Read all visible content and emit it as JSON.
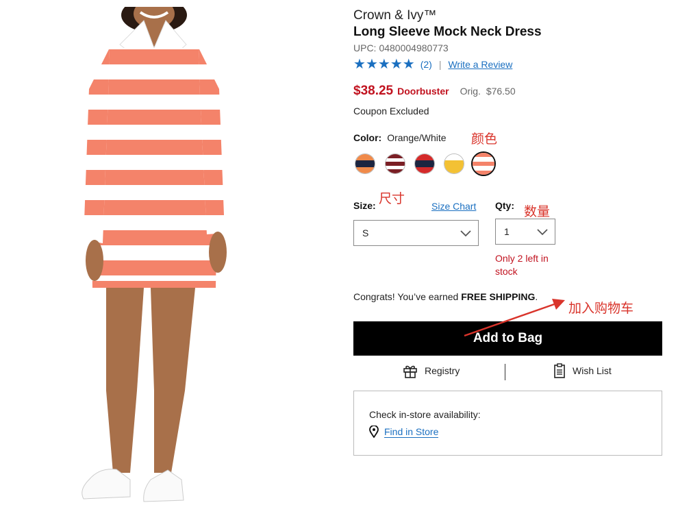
{
  "product": {
    "brand": "Crown & Ivy™",
    "title": "Long Sleeve Mock Neck Dress",
    "upc_label": "UPC:",
    "upc": "0480004980773",
    "rating_stars": 5,
    "review_count": "(2)",
    "write_review": "Write a Review"
  },
  "price": {
    "sale": "$38.25",
    "badge": "Doorbuster",
    "orig_label": "Orig.",
    "orig": "$76.50",
    "coupon_note": "Coupon Excluded"
  },
  "color": {
    "label": "Color:",
    "selected": "Orange/White",
    "swatches": [
      {
        "name": "navy-orange",
        "colors": [
          "#f08a4a",
          "#1c2540",
          "#f08a4a"
        ]
      },
      {
        "name": "maroon-white",
        "colors": [
          "#7a1f25",
          "#ffffff",
          "#7a1f25",
          "#ffffff",
          "#7a1f25"
        ]
      },
      {
        "name": "red-navy",
        "colors": [
          "#d42a2a",
          "#1c2540",
          "#d42a2a"
        ]
      },
      {
        "name": "yellow-white",
        "colors": [
          "#ffffff",
          "#f3c134",
          "#f3c134"
        ]
      },
      {
        "name": "orange-white",
        "colors": [
          "#f4836a",
          "#ffffff",
          "#f4836a",
          "#ffffff",
          "#f4836a"
        ]
      }
    ]
  },
  "size": {
    "label": "Size:",
    "chart_link": "Size Chart",
    "selected": "S"
  },
  "qty": {
    "label": "Qty:",
    "selected": "1",
    "stock_msg": "Only 2 left in stock"
  },
  "shipping": {
    "prefix": "Congrats! You’ve earned ",
    "bold": "FREE SHIPPING",
    "suffix": "."
  },
  "add_to_bag": "Add to Bag",
  "utility": {
    "registry": "Registry",
    "wishlist": "Wish List"
  },
  "store": {
    "availability": "Check in-store availability:",
    "find": "Find in Store"
  },
  "annotations": {
    "color": "颜色",
    "size": "尺寸",
    "qty": "数量",
    "cart": "加入购物车"
  },
  "colors": {
    "link_blue": "#1a6fc0",
    "sale_red": "#c1121f",
    "annotation_red": "#d9342b",
    "dress_orange": "#f4836a"
  }
}
